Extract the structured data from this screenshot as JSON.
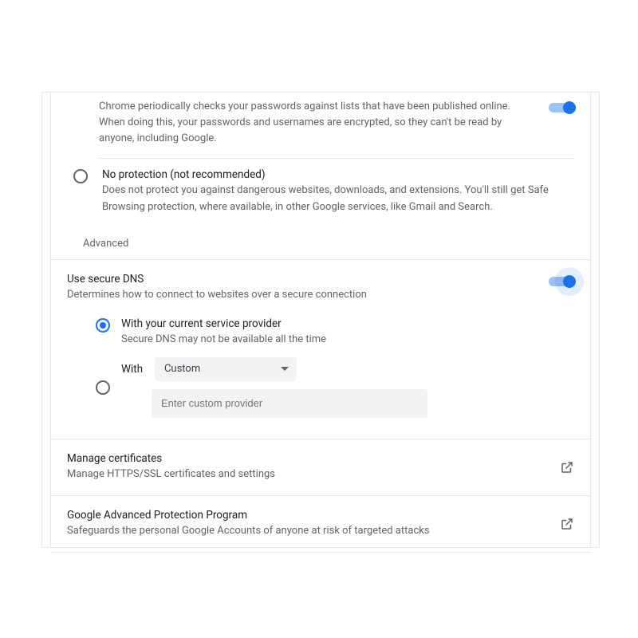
{
  "passwordCheck": {
    "description": "Chrome periodically checks your passwords against lists that have been published online. When doing this, your passwords and usernames are encrypted, so they can't be read by anyone, including Google.",
    "enabled": true
  },
  "noProtection": {
    "title": "No protection (not recommended)",
    "description": "Does not protect you against dangerous websites, downloads, and extensions. You'll still get Safe Browsing protection, where available, in other Google services, like Gmail and Search."
  },
  "sectionHeading": "Advanced",
  "secureDns": {
    "title": "Use secure DNS",
    "description": "Determines how to connect to websites over a secure connection",
    "enabled": true,
    "options": {
      "current": {
        "label": "With your current service provider",
        "sub": "Secure DNS may not be available all the time",
        "selected": true
      },
      "custom": {
        "label": "With",
        "selectValue": "Custom",
        "inputPlaceholder": "Enter custom provider",
        "selected": false
      }
    }
  },
  "certificates": {
    "title": "Manage certificates",
    "description": "Manage HTTPS/SSL certificates and settings"
  },
  "advancedProtection": {
    "title": "Google Advanced Protection Program",
    "description": "Safeguards the personal Google Accounts of anyone at risk of targeted attacks"
  }
}
